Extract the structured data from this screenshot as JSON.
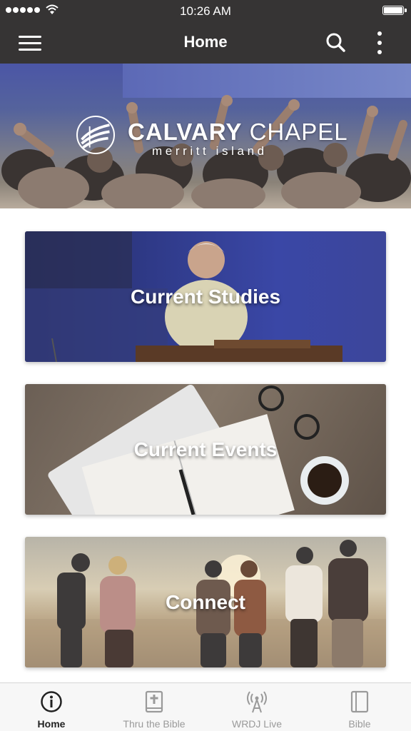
{
  "status_bar": {
    "time": "10:26 AM"
  },
  "nav": {
    "title": "Home"
  },
  "hero": {
    "logo_title_bold": "CALVARY",
    "logo_title_light": "CHAPEL",
    "logo_subtitle": "merritt island"
  },
  "cards": [
    {
      "label": "Current Studies"
    },
    {
      "label": "Current Events"
    },
    {
      "label": "Connect"
    }
  ],
  "tabs": [
    {
      "label": "Home",
      "icon": "info-icon",
      "active": true
    },
    {
      "label": "Thru the Bible",
      "icon": "bible-book-icon",
      "active": false
    },
    {
      "label": "WRDJ Live",
      "icon": "broadcast-icon",
      "active": false
    },
    {
      "label": "Bible",
      "icon": "book-icon",
      "active": false
    }
  ],
  "colors": {
    "header_bg": "#363434",
    "tab_bar_bg": "#f7f7f7",
    "tab_active": "#222222",
    "tab_inactive": "#9a9a9a"
  }
}
